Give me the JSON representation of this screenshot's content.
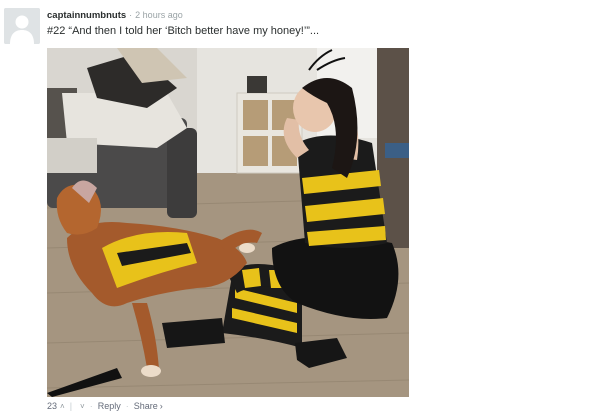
{
  "comment": {
    "username": "captainnumbnuts",
    "separator": "·",
    "timestamp": "2 hours ago",
    "text": "#22 “And then I told her ‘Bitch better have my honey!’”..."
  },
  "avatar": {
    "icon": "default-user-icon"
  },
  "photo": {
    "subject": "bee-costume-photo"
  },
  "actions": {
    "upvote_count": "23",
    "upvote_icon": "˄",
    "divider": "|",
    "downvote_icon": "˅",
    "dot": "·",
    "reply_label": "Reply",
    "share_label": "Share",
    "share_chevron": "›"
  },
  "colors": {
    "username": "#2a2e2e",
    "muted": "#9aa3a6",
    "bee_yellow": "#e8c21a",
    "bee_black": "#1b1b1b"
  }
}
